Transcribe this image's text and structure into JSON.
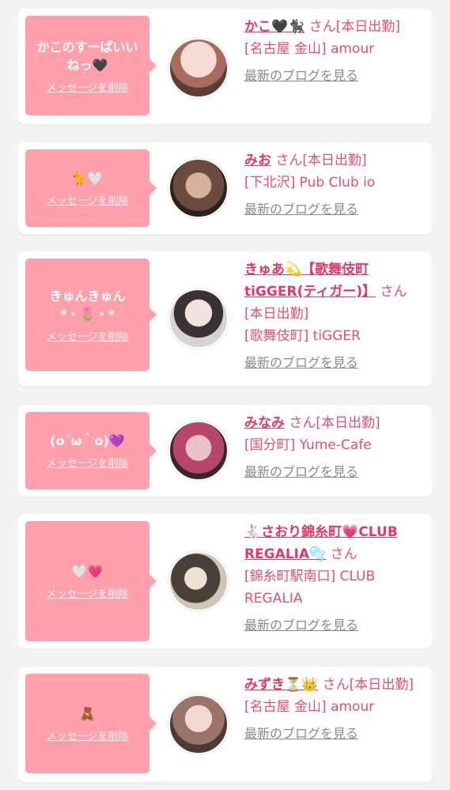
{
  "cards": [
    {
      "message": "かこのすーぱいいねっ🖤",
      "delete_label": "メッセージを削除",
      "name": "かこ🖤🐈‍⬛",
      "san": "さん",
      "status": "[本日出勤]",
      "shop": "[名古屋 金山] amour",
      "blog_label": "最新のブログを見る",
      "avatar_colors": [
        "#f3d6d0",
        "#8e5b4e"
      ]
    },
    {
      "message": "🐈🤍",
      "delete_label": "メッセージを削除",
      "name": "みお",
      "san": "さん",
      "status": "[本日出勤]",
      "shop": "[下北沢] Pub Club io",
      "blog_label": "最新のブログを見る",
      "avatar_colors": [
        "#6b4a3f",
        "#c9a08a"
      ]
    },
    {
      "message": "きゅんきゅん *・🌷・*",
      "delete_label": "メッセージを削除",
      "name": "きゅあ💫【歌舞伎町tiGGER(ティガー)】",
      "san": "さん",
      "status": "[本日出勤]",
      "shop": "[歌舞伎町] tiGGER",
      "blog_label": "最新のブログを見る",
      "avatar_colors": [
        "#e9e2e6",
        "#3b3236"
      ]
    },
    {
      "message": "(o´ω｀o)💜",
      "delete_label": "メッセージを削除",
      "name": "みなみ",
      "san": "さん",
      "status": "[本日出勤]",
      "shop": "[国分町] Yume-Cafe",
      "blog_label": "最新のブログを見る",
      "avatar_colors": [
        "#b8466a",
        "#4a2a3a"
      ]
    },
    {
      "message": "🤍💗",
      "delete_label": "メッセージを削除",
      "name": "🐇さおり錦糸町💗CLUB REGALIA🫧",
      "san": "さん",
      "status": "",
      "shop": "[錦糸町駅南口] CLUB REGALIA",
      "blog_label": "最新のブログを見る",
      "avatar_colors": [
        "#d9d2c8",
        "#4a4038"
      ]
    },
    {
      "message": "🧸",
      "delete_label": "メッセージを削除",
      "name": "みずき⏳👑",
      "san": "さん",
      "status": "[本日出勤]",
      "shop": "[名古屋 金山] amour",
      "blog_label": "最新のブログを見る",
      "avatar_colors": [
        "#e6c7bf",
        "#7a5a50"
      ]
    }
  ]
}
